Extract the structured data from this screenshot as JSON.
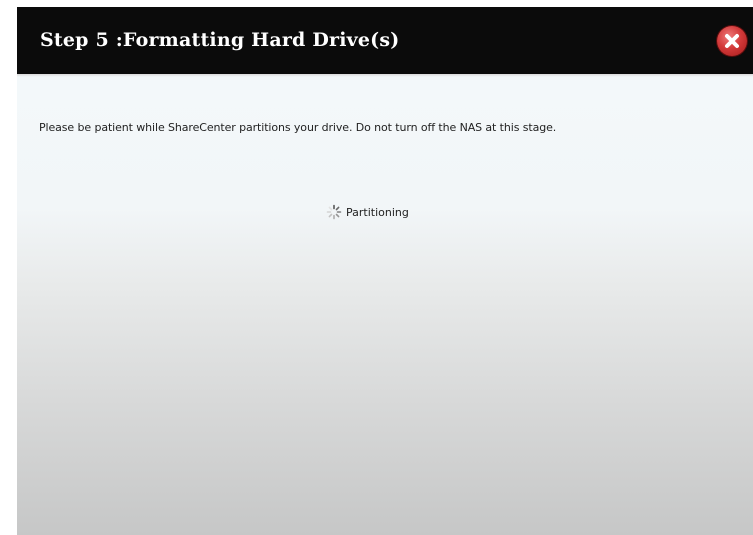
{
  "dialog": {
    "title": "Step 5 :Formatting Hard Drive(s)",
    "close_icon": "close-icon",
    "message": "Please be patient while ShareCenter partitions your drive. Do not turn off the NAS at this stage.",
    "status": {
      "icon": "spinner-icon",
      "text": "Partitioning"
    }
  },
  "colors": {
    "titlebar": "#0b0b0b",
    "title_text": "#ffffff",
    "close_button": "#d33a3a",
    "body_top": "#f4f9fb",
    "body_bottom": "#c6c7c7",
    "text": "#222222"
  }
}
